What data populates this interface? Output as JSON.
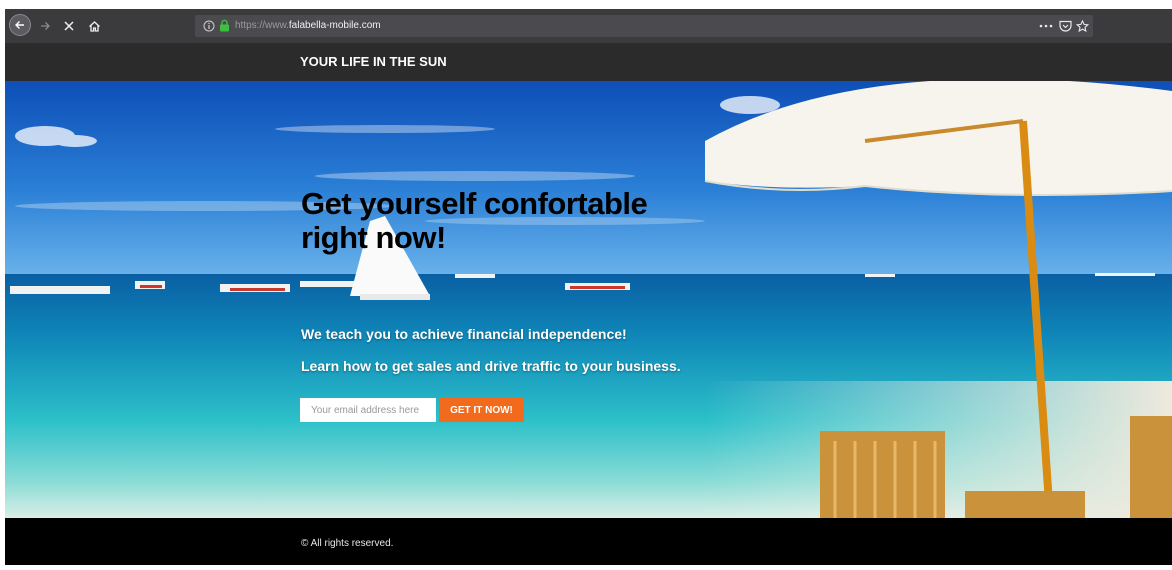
{
  "browser": {
    "url_prefix": "https://www.",
    "url_domain": "falabella-mobile.com",
    "icons": [
      "back-arrow-icon",
      "forward-arrow-icon",
      "stop-x-icon",
      "home-icon",
      "info-icon",
      "lock-icon",
      "more-dots-icon",
      "pocket-icon",
      "bookmark-star-icon"
    ]
  },
  "site": {
    "brand": "YOUR LIFE IN THE SUN"
  },
  "hero": {
    "headline_line1": "Get yourself confortable",
    "headline_line2": "right now!",
    "subtitle1": "We teach you to achieve financial independence!",
    "subtitle2": "Learn how to get sales and drive traffic to your business.",
    "email_placeholder": "Your email address here",
    "cta_label": "GET IT NOW!"
  },
  "footer": {
    "copyright": "© All rights reserved."
  },
  "colors": {
    "cta": "#f26b1d",
    "header_bg": "#2b2b2b",
    "footer_bg": "#000000",
    "browser_bg": "#3b3b3d"
  }
}
